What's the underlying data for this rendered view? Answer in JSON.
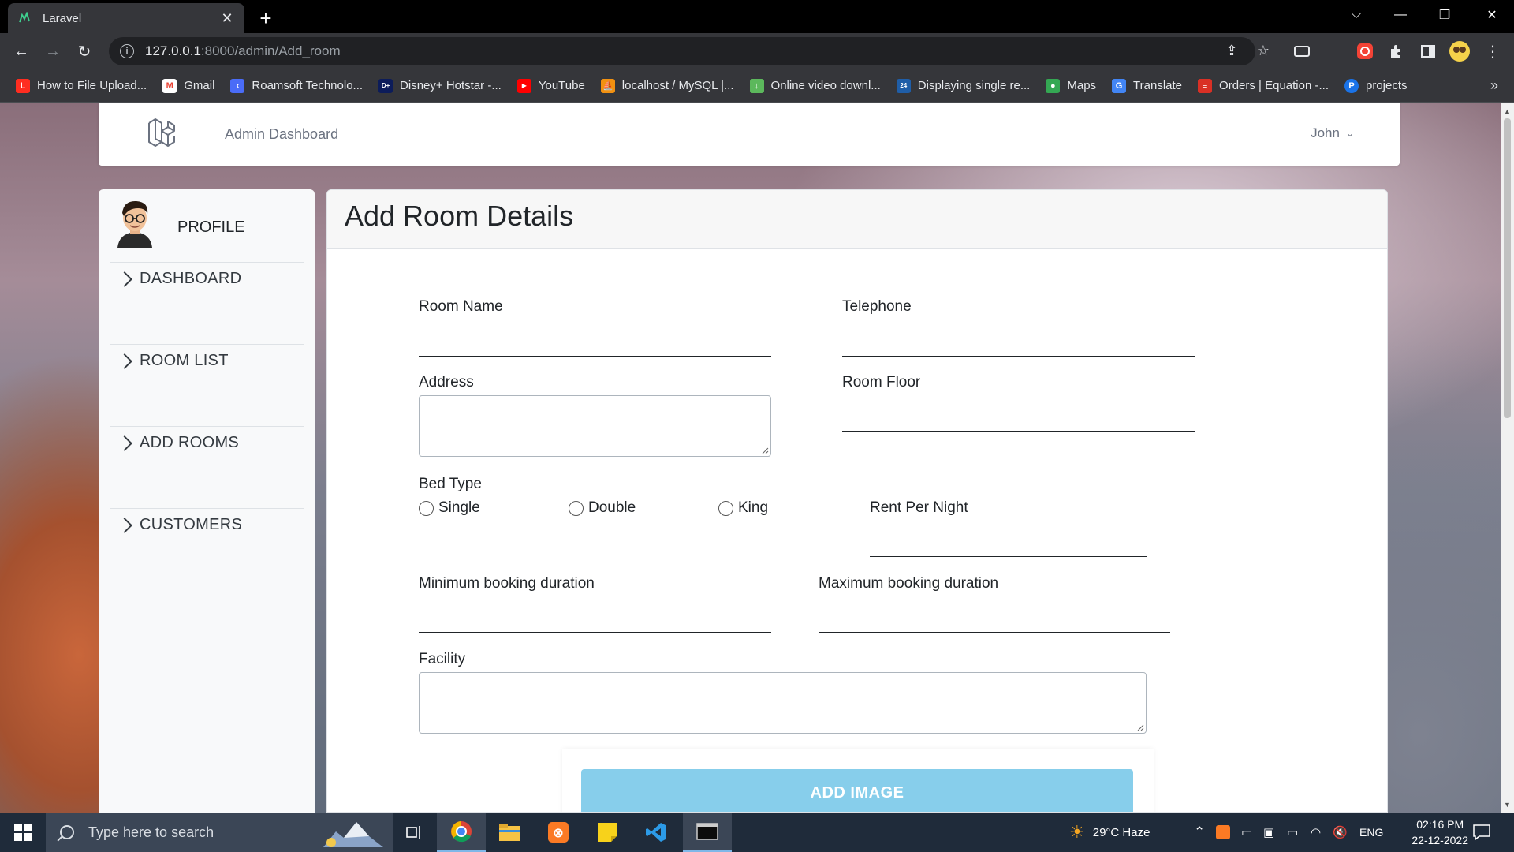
{
  "browser": {
    "tab_title": "Laravel",
    "url_host": "127.0.0.1",
    "url_rest": ":8000/admin/Add_room",
    "bookmarks": [
      {
        "label": "How to File Upload...",
        "icon": "laravel-icon",
        "color": "#ff2d20"
      },
      {
        "label": "Gmail",
        "icon": "gmail-icon",
        "color": "#ea4335"
      },
      {
        "label": "Roamsoft Technolo...",
        "icon": "roamsoft-icon",
        "color": "#4a6cf7"
      },
      {
        "label": "Disney+ Hotstar -...",
        "icon": "hotstar-icon",
        "color": "#0c1c5a"
      },
      {
        "label": "YouTube",
        "icon": "youtube-icon",
        "color": "#ff0000"
      },
      {
        "label": "localhost / MySQL |...",
        "icon": "phpmyadmin-icon",
        "color": "#f29111"
      },
      {
        "label": "Online video downl...",
        "icon": "download-icon",
        "color": "#5cb85c"
      },
      {
        "label": "Displaying single re...",
        "icon": "geeks-icon",
        "color": "#1f5ea8"
      },
      {
        "label": "Maps",
        "icon": "maps-icon",
        "color": "#34a853"
      },
      {
        "label": "Translate",
        "icon": "translate-icon",
        "color": "#4285f4"
      },
      {
        "label": "Orders | Equation -...",
        "icon": "equation-icon",
        "color": "#d93025"
      },
      {
        "label": "projects",
        "icon": "projects-icon",
        "color": "#1a73e8"
      }
    ],
    "more_label": "»"
  },
  "header": {
    "admin_link": "Admin Dashboard",
    "user_name": "John"
  },
  "sidebar": {
    "profile_label": "PROFILE",
    "items": [
      {
        "label": "DASHBOARD"
      },
      {
        "label": "ROOM LIST"
      },
      {
        "label": "ADD ROOMS"
      },
      {
        "label": "CUSTOMERS"
      }
    ]
  },
  "form": {
    "title": "Add Room Details",
    "room_name_label": "Room Name",
    "telephone_label": "Telephone",
    "address_label": "Address",
    "room_floor_label": "Room Floor",
    "bed_type_label": "Bed Type",
    "bed_options": [
      "Single",
      "Double",
      "King"
    ],
    "rent_label": "Rent Per Night",
    "min_duration_label": "Minimum booking duration",
    "max_duration_label": "Maximum booking duration",
    "facility_label": "Facility",
    "add_image_button": "ADD IMAGE"
  },
  "taskbar": {
    "search_placeholder": "Type here to search",
    "weather": "29°C  Haze",
    "language": "ENG",
    "time": "02:16 PM",
    "date": "22-12-2022"
  },
  "colors": {
    "accent_button": "#87ceeb",
    "chrome_dark": "#35363a"
  }
}
